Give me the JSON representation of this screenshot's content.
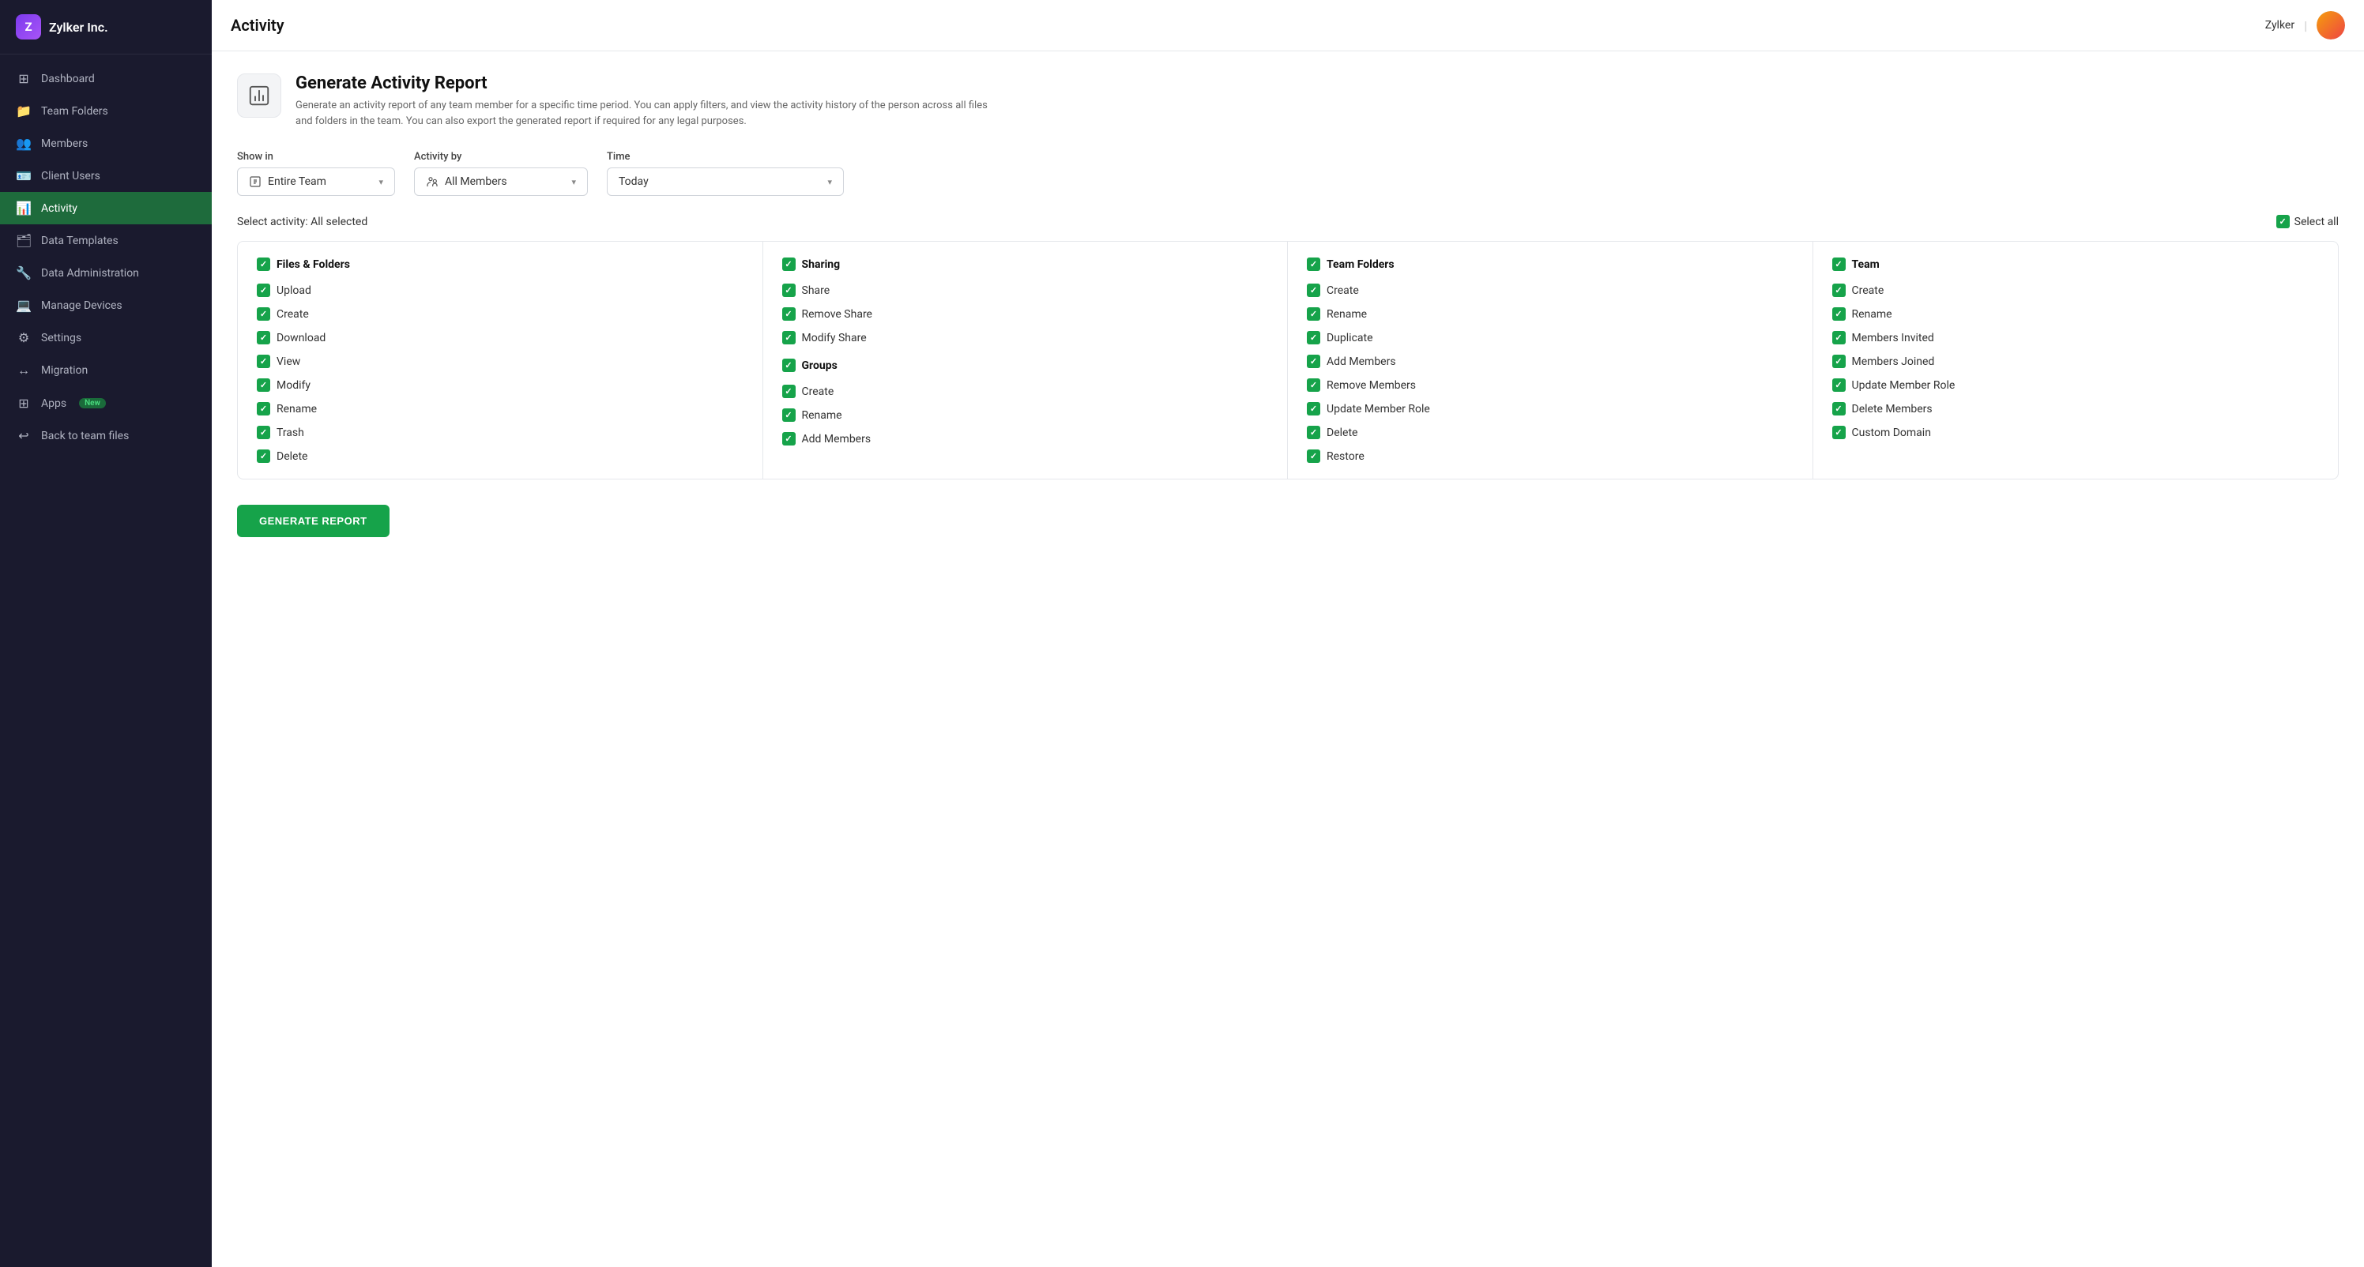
{
  "app": {
    "logo_letter": "Z",
    "company_name": "Zylker Inc."
  },
  "sidebar": {
    "items": [
      {
        "id": "dashboard",
        "label": "Dashboard",
        "icon": "⊞"
      },
      {
        "id": "team-folders",
        "label": "Team Folders",
        "icon": "📁"
      },
      {
        "id": "members",
        "label": "Members",
        "icon": "👥"
      },
      {
        "id": "client-users",
        "label": "Client Users",
        "icon": "🪪"
      },
      {
        "id": "activity",
        "label": "Activity",
        "icon": "📊",
        "active": true
      },
      {
        "id": "data-templates",
        "label": "Data Templates",
        "icon": "🗂"
      },
      {
        "id": "data-administration",
        "label": "Data Administration",
        "icon": "🔧"
      },
      {
        "id": "manage-devices",
        "label": "Manage Devices",
        "icon": "💻"
      },
      {
        "id": "settings",
        "label": "Settings",
        "icon": "⚙"
      },
      {
        "id": "migration",
        "label": "Migration",
        "icon": "↔"
      },
      {
        "id": "apps",
        "label": "Apps",
        "icon": "⊞",
        "badge": "New"
      },
      {
        "id": "back-to-team-files",
        "label": "Back to team files",
        "icon": "↩"
      }
    ]
  },
  "topbar": {
    "title": "Activity",
    "user": "Zylker"
  },
  "report": {
    "title": "Generate Activity Report",
    "description": "Generate an activity report of any team member for a specific time period. You can apply filters, and view the activity history of the person across all files and folders in the team. You can also export the generated report if required for any legal purposes."
  },
  "filters": {
    "show_in_label": "Show in",
    "show_in_value": "Entire Team",
    "activity_by_label": "Activity by",
    "activity_by_value": "All Members",
    "time_label": "Time",
    "time_value": "Today"
  },
  "activity": {
    "select_label": "Select activity: All selected",
    "select_all_label": "Select all",
    "columns": [
      {
        "id": "files-folders",
        "header": "Files & Folders",
        "items": [
          "Upload",
          "Create",
          "Download",
          "View",
          "Modify",
          "Rename",
          "Trash",
          "Delete"
        ]
      },
      {
        "id": "sharing",
        "header": "Sharing",
        "items": [
          "Share",
          "Remove Share",
          "Modify Share"
        ],
        "sub_header": "Groups",
        "sub_items": [
          "Create",
          "Rename",
          "Add Members"
        ]
      },
      {
        "id": "team-folders",
        "header": "Team Folders",
        "items": [
          "Create",
          "Rename",
          "Duplicate",
          "Add Members",
          "Remove Members",
          "Update Member Role",
          "Delete",
          "Restore"
        ]
      },
      {
        "id": "team",
        "header": "Team",
        "items": [
          "Create",
          "Rename",
          "Members Invited",
          "Members Joined",
          "Update Member Role",
          "Delete Members",
          "Custom Domain"
        ]
      }
    ]
  },
  "generate_button_label": "GENERATE REPORT"
}
